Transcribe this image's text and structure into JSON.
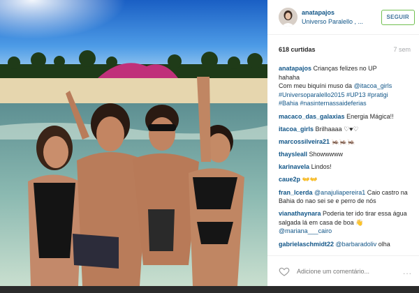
{
  "post": {
    "username": "anatapajos",
    "location": "Universo Paralello , ...",
    "follow_label": "SEGUIR",
    "likes": "618 curtidas",
    "time": "7 sem"
  },
  "caption": {
    "username": "anatapajos",
    "lines": [
      "Crianças felizes no UP",
      "hahaha",
      "Com meu biquíni muso da",
      "#Universoparalello2015 #UP13 #pratigi",
      "#Bahia #nasinternassaideferias"
    ],
    "mention": "@itacoa_girls"
  },
  "comments": [
    {
      "user": "macaco_das_galaxias",
      "text": "Energia Mágica!!"
    },
    {
      "user": "itacoa_girls",
      "text": "Brilhaaaa ♡♥♡"
    },
    {
      "user": "marcossilveira21",
      "text": "🦗🦗🦗"
    },
    {
      "user": "thaysleall",
      "text": "Showwwww"
    },
    {
      "user": "karinavela",
      "text": "Lindos!"
    },
    {
      "user": "caue2p",
      "text": "👐👐"
    },
    {
      "user": "fran_lcerda",
      "mention": "@anajuliapereira1",
      "text": "Caio castro na Bahia do nao sei se e perro de nós"
    },
    {
      "user": "vianathaynara",
      "text": "Poderia ter ido tirar essa água salgada lá em casa de boa 👋",
      "mention": "@mariana___cairo"
    },
    {
      "user": "gabrielaschmidt22",
      "mention": "@barbaradoliv",
      "text": "olha"
    }
  ],
  "add_comment": {
    "placeholder": "Adicione um comentário...",
    "more": "..."
  },
  "colors": {
    "link": "#125688",
    "follow_border": "#70c050",
    "follow_text": "#3f729b",
    "sky_top": "#1f6fd6",
    "sea": "#7fb8b0"
  },
  "icons": {
    "like": "heart-icon",
    "more": "more-options-icon"
  }
}
